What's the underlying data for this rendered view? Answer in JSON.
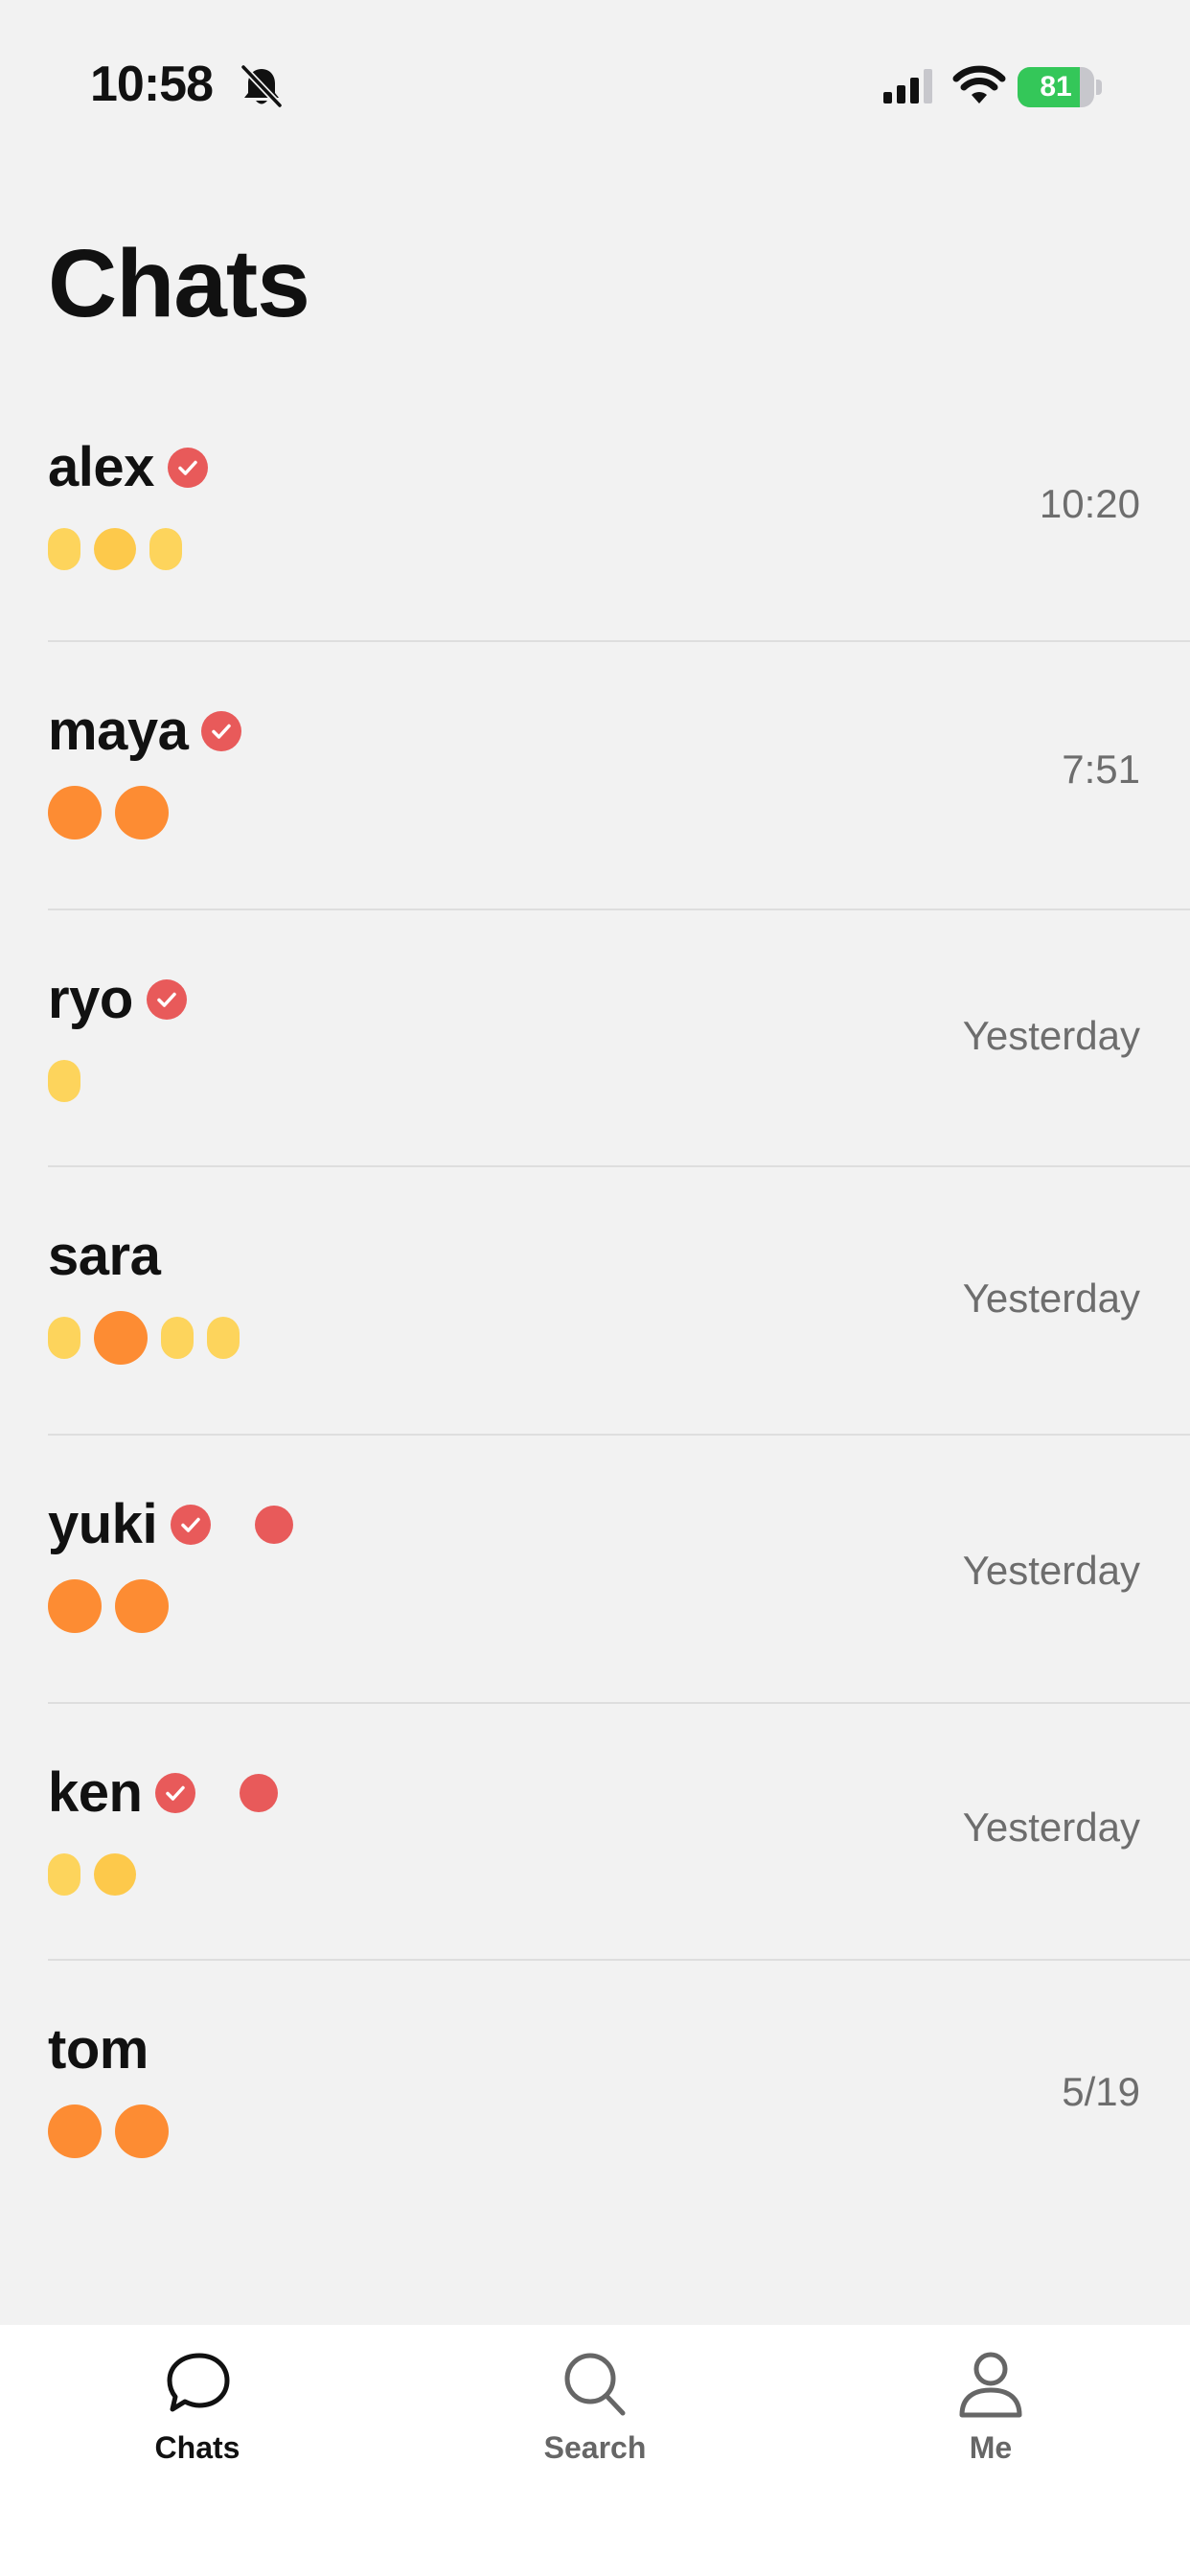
{
  "status_bar": {
    "time": "10:58",
    "battery_level": "81",
    "battery_fraction": 0.81,
    "icons": [
      "bell-slash-icon",
      "cellular-signal-icon",
      "wifi-icon",
      "battery-charging-icon"
    ]
  },
  "header": {
    "title": "Chats"
  },
  "colors": {
    "verified": "#e85a5a",
    "unread": "#e85a5a",
    "blob_orange": "#fd8c33",
    "blob_yellow": "#fdc94b",
    "blob_yellow_light": "#fdd45c",
    "battery_green": "#34c759",
    "time_gray": "#6d6d6d"
  },
  "chats": [
    {
      "name": "alex",
      "time": "10:20",
      "verified": true,
      "unread": false,
      "blobs": [
        "yellow-small",
        "amber-med",
        "yellow-small"
      ]
    },
    {
      "name": "maya",
      "time": "7:51",
      "verified": true,
      "unread": false,
      "blobs": [
        "orange-big",
        "orange-big"
      ]
    },
    {
      "name": "ryo",
      "time": "Yesterday",
      "verified": true,
      "unread": false,
      "blobs": [
        "yellow-small"
      ]
    },
    {
      "name": "sara",
      "time": "Yesterday",
      "verified": false,
      "unread": false,
      "blobs": [
        "yellow-small",
        "orange-big",
        "yellow-small",
        "yellow-small"
      ]
    },
    {
      "name": "yuki",
      "time": "Yesterday",
      "verified": true,
      "unread": true,
      "blobs": [
        "orange-big",
        "orange-big"
      ]
    },
    {
      "name": "ken",
      "time": "Yesterday",
      "verified": true,
      "unread": true,
      "blobs": [
        "yellow-small",
        "amber-med"
      ]
    },
    {
      "name": "tom",
      "time": "5/19",
      "verified": false,
      "unread": false,
      "blobs": [
        "orange-big",
        "orange-big"
      ]
    }
  ],
  "tab_bar": {
    "tabs": [
      {
        "label": "Chats",
        "icon": "chat-bubble-icon",
        "active": true
      },
      {
        "label": "Search",
        "icon": "search-icon",
        "active": false
      },
      {
        "label": "Me",
        "icon": "person-icon",
        "active": false
      }
    ]
  }
}
